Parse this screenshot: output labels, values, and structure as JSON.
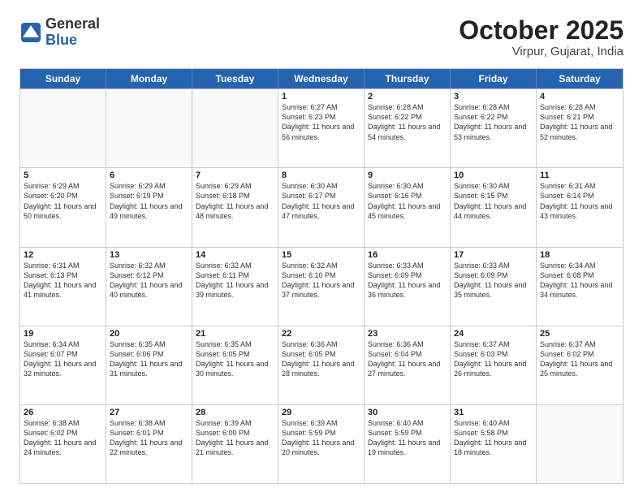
{
  "logo": {
    "general": "General",
    "blue": "Blue"
  },
  "title": {
    "month_year": "October 2025",
    "location": "Virpur, Gujarat, India"
  },
  "header_days": [
    "Sunday",
    "Monday",
    "Tuesday",
    "Wednesday",
    "Thursday",
    "Friday",
    "Saturday"
  ],
  "weeks": [
    [
      {
        "day": "",
        "empty": true
      },
      {
        "day": "",
        "empty": true
      },
      {
        "day": "",
        "empty": true
      },
      {
        "day": "1",
        "sunrise": "6:27 AM",
        "sunset": "6:23 PM",
        "daylight": "11 hours and 56 minutes."
      },
      {
        "day": "2",
        "sunrise": "6:28 AM",
        "sunset": "6:22 PM",
        "daylight": "11 hours and 54 minutes."
      },
      {
        "day": "3",
        "sunrise": "6:28 AM",
        "sunset": "6:22 PM",
        "daylight": "11 hours and 53 minutes."
      },
      {
        "day": "4",
        "sunrise": "6:28 AM",
        "sunset": "6:21 PM",
        "daylight": "11 hours and 52 minutes."
      }
    ],
    [
      {
        "day": "5",
        "sunrise": "6:29 AM",
        "sunset": "6:20 PM",
        "daylight": "11 hours and 50 minutes."
      },
      {
        "day": "6",
        "sunrise": "6:29 AM",
        "sunset": "6:19 PM",
        "daylight": "11 hours and 49 minutes."
      },
      {
        "day": "7",
        "sunrise": "6:29 AM",
        "sunset": "6:18 PM",
        "daylight": "11 hours and 48 minutes."
      },
      {
        "day": "8",
        "sunrise": "6:30 AM",
        "sunset": "6:17 PM",
        "daylight": "11 hours and 47 minutes."
      },
      {
        "day": "9",
        "sunrise": "6:30 AM",
        "sunset": "6:16 PM",
        "daylight": "11 hours and 45 minutes."
      },
      {
        "day": "10",
        "sunrise": "6:30 AM",
        "sunset": "6:15 PM",
        "daylight": "11 hours and 44 minutes."
      },
      {
        "day": "11",
        "sunrise": "6:31 AM",
        "sunset": "6:14 PM",
        "daylight": "11 hours and 43 minutes."
      }
    ],
    [
      {
        "day": "12",
        "sunrise": "6:31 AM",
        "sunset": "6:13 PM",
        "daylight": "11 hours and 41 minutes."
      },
      {
        "day": "13",
        "sunrise": "6:32 AM",
        "sunset": "6:12 PM",
        "daylight": "11 hours and 40 minutes."
      },
      {
        "day": "14",
        "sunrise": "6:32 AM",
        "sunset": "6:11 PM",
        "daylight": "11 hours and 39 minutes."
      },
      {
        "day": "15",
        "sunrise": "6:32 AM",
        "sunset": "6:10 PM",
        "daylight": "11 hours and 37 minutes."
      },
      {
        "day": "16",
        "sunrise": "6:33 AM",
        "sunset": "6:09 PM",
        "daylight": "11 hours and 36 minutes."
      },
      {
        "day": "17",
        "sunrise": "6:33 AM",
        "sunset": "6:09 PM",
        "daylight": "11 hours and 35 minutes."
      },
      {
        "day": "18",
        "sunrise": "6:34 AM",
        "sunset": "6:08 PM",
        "daylight": "11 hours and 34 minutes."
      }
    ],
    [
      {
        "day": "19",
        "sunrise": "6:34 AM",
        "sunset": "6:07 PM",
        "daylight": "11 hours and 32 minutes."
      },
      {
        "day": "20",
        "sunrise": "6:35 AM",
        "sunset": "6:06 PM",
        "daylight": "11 hours and 31 minutes."
      },
      {
        "day": "21",
        "sunrise": "6:35 AM",
        "sunset": "6:05 PM",
        "daylight": "11 hours and 30 minutes."
      },
      {
        "day": "22",
        "sunrise": "6:36 AM",
        "sunset": "6:05 PM",
        "daylight": "11 hours and 28 minutes."
      },
      {
        "day": "23",
        "sunrise": "6:36 AM",
        "sunset": "6:04 PM",
        "daylight": "11 hours and 27 minutes."
      },
      {
        "day": "24",
        "sunrise": "6:37 AM",
        "sunset": "6:03 PM",
        "daylight": "11 hours and 26 minutes."
      },
      {
        "day": "25",
        "sunrise": "6:37 AM",
        "sunset": "6:02 PM",
        "daylight": "11 hours and 25 minutes."
      }
    ],
    [
      {
        "day": "26",
        "sunrise": "6:38 AM",
        "sunset": "6:02 PM",
        "daylight": "11 hours and 24 minutes."
      },
      {
        "day": "27",
        "sunrise": "6:38 AM",
        "sunset": "6:01 PM",
        "daylight": "11 hours and 22 minutes."
      },
      {
        "day": "28",
        "sunrise": "6:39 AM",
        "sunset": "6:00 PM",
        "daylight": "11 hours and 21 minutes."
      },
      {
        "day": "29",
        "sunrise": "6:39 AM",
        "sunset": "5:59 PM",
        "daylight": "11 hours and 20 minutes."
      },
      {
        "day": "30",
        "sunrise": "6:40 AM",
        "sunset": "5:59 PM",
        "daylight": "11 hours and 19 minutes."
      },
      {
        "day": "31",
        "sunrise": "6:40 AM",
        "sunset": "5:58 PM",
        "daylight": "11 hours and 18 minutes."
      },
      {
        "day": "",
        "empty": true
      }
    ]
  ],
  "labels": {
    "sunrise": "Sunrise:",
    "sunset": "Sunset:",
    "daylight": "Daylight:"
  }
}
